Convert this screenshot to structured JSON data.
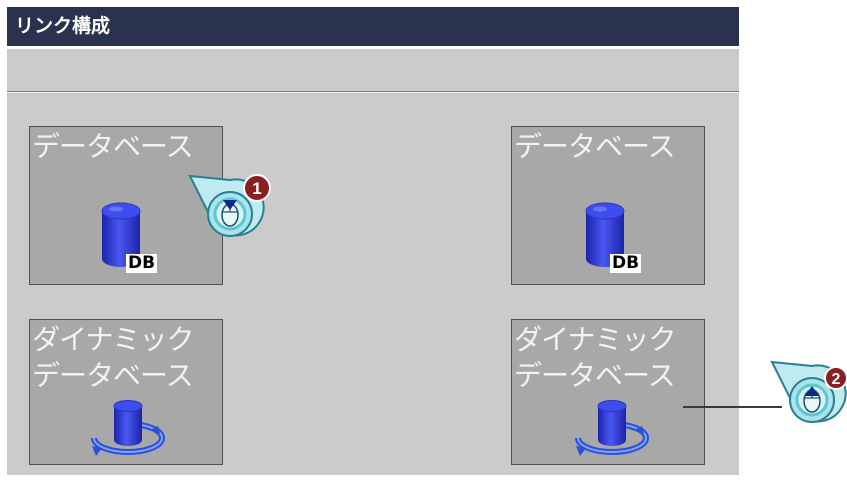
{
  "window": {
    "title": "リンク構成"
  },
  "tiles": [
    {
      "label": "データベース",
      "icon": "database-icon",
      "badge": "DB"
    },
    {
      "label": "データベース",
      "icon": "database-icon",
      "badge": "DB"
    },
    {
      "label": "ダイナミック\nデータベース",
      "icon": "dynamic-database-icon"
    },
    {
      "label": "ダイナミック\nデータベース",
      "icon": "dynamic-database-icon"
    }
  ],
  "callouts": [
    {
      "number": "1",
      "icon": "mouse-click-icon"
    },
    {
      "number": "2",
      "icon": "mouse-click-icon"
    }
  ],
  "colors": {
    "titlebar": "#29324e",
    "panel": "#cbcbcb",
    "tile": "#a8a8a8",
    "cylinder": "#2f3ccf",
    "callout_badge": "#8a2020",
    "callout_ring": "#5ec6cf"
  }
}
